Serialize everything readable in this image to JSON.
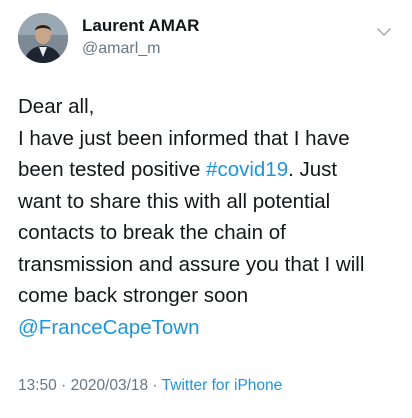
{
  "author": {
    "display_name": "Laurent AMAR",
    "handle": "@amarl_m",
    "avatar_icon": "profile-photo"
  },
  "menu_icon": "chevron-down-icon",
  "tweet": {
    "line1": "Dear all,",
    "line2": "I have just been informed that I have",
    "line3_pre": "been tested positive ",
    "hashtag": "#covid19",
    "line3_post": ". Just",
    "line4": "want to share this with all potential",
    "line5": "contacts to break the chain of",
    "line6": "transmission and assure you that I will",
    "line7": "come back stronger soon",
    "mention": "@FranceCapeTown"
  },
  "meta": {
    "time": "13:50",
    "separator": " · ",
    "date": "2020/03/18",
    "source": "Twitter for iPhone"
  },
  "colors": {
    "link": "#1b95e0",
    "secondary_text": "#657786",
    "primary_text": "#14171a"
  }
}
